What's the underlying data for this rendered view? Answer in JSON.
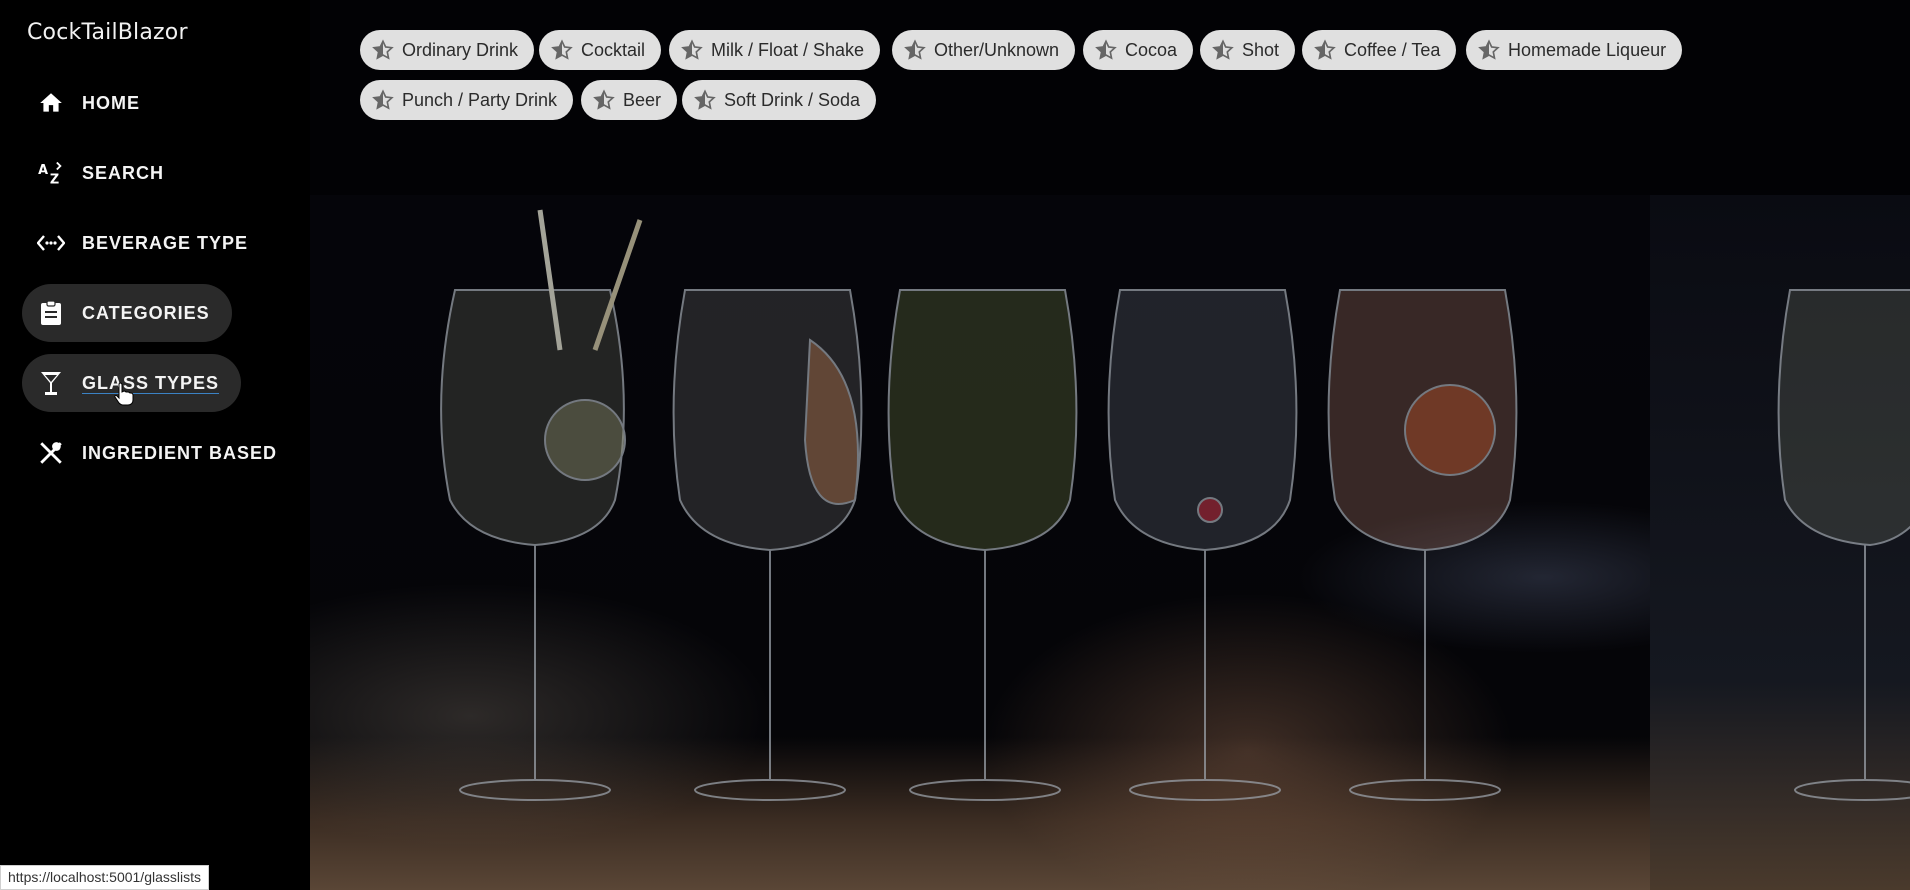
{
  "app": {
    "title": "CockTailBlazor"
  },
  "nav": {
    "items": [
      {
        "label": "HOME",
        "icon": "home-icon"
      },
      {
        "label": "SEARCH",
        "icon": "sort-az-icon"
      },
      {
        "label": "BEVERAGE TYPE",
        "icon": "code-arrows-icon"
      },
      {
        "label": "CATEGORIES",
        "icon": "clipboard-icon",
        "active": true
      },
      {
        "label": "GLASS TYPES",
        "icon": "glass-icon",
        "hovered": true
      },
      {
        "label": "INGREDIENT BASED",
        "icon": "utensils-icon"
      }
    ]
  },
  "categories": {
    "chips": [
      "Ordinary Drink",
      "Cocktail",
      "Milk / Float / Shake",
      "Other/Unknown",
      "Cocoa",
      "Shot",
      "Coffee / Tea",
      "Homemade Liqueur",
      "Punch / Party Drink",
      "Beer",
      "Soft Drink / Soda"
    ]
  },
  "status": {
    "url": "https://localhost:5001/glasslists"
  },
  "colors": {
    "chip_bg": "#e0e0e0",
    "active_nav_bg": "#2a2a2a",
    "background": "#000000"
  }
}
